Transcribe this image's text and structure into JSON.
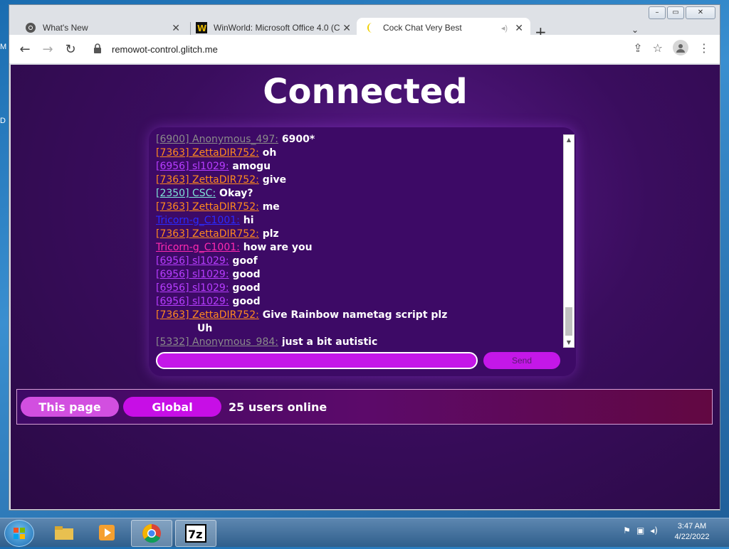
{
  "desktop": {
    "edge_letter_1": "M",
    "edge_letter_2": "D"
  },
  "window": {
    "minimize": "–",
    "maximize": "▭",
    "close": "✕"
  },
  "tabs": [
    {
      "title": "What's New",
      "icon": "chrome-icon"
    },
    {
      "title": "WinWorld: Microsoft Office 4.0 (C",
      "icon": "winworld-icon"
    },
    {
      "title": "Cock Chat Very Best",
      "icon": "moon-icon",
      "active": true
    }
  ],
  "toolbar": {
    "url": "remowot-control.glitch.me"
  },
  "page": {
    "title": "Connected",
    "messages": [
      {
        "who": "[6900] Anonymous_497:",
        "text": "6900*",
        "color": "#8a8a8a"
      },
      {
        "who": "[7363] ZettaDIR752:",
        "text": "oh",
        "color": "#ff8a1e"
      },
      {
        "who": "[6956] sl1029:",
        "text": "amogu",
        "color": "#b73dff"
      },
      {
        "who": "[7363] ZettaDIR752:",
        "text": "give",
        "color": "#ff8a1e"
      },
      {
        "who": "[2350] CSC:",
        "text": "Okay?",
        "color": "#7fe3d6"
      },
      {
        "who": "[7363] ZettaDIR752:",
        "text": "me",
        "color": "#ff8a1e"
      },
      {
        "who": "Tricorn-g_C1001:",
        "text": "hi",
        "color": "#2a2aff"
      },
      {
        "who": "[7363] ZettaDIR752:",
        "text": "plz",
        "color": "#ff8a1e"
      },
      {
        "who": "Tricorn-g_C1001:",
        "text": "how are you",
        "color": "#ff2ab0"
      },
      {
        "who": "[6956] sl1029:",
        "text": "goof",
        "color": "#b73dff"
      },
      {
        "who": "[6956] sl1029:",
        "text": "good",
        "color": "#b73dff"
      },
      {
        "who": "[6956] sl1029:",
        "text": "good",
        "color": "#b73dff"
      },
      {
        "who": "[6956] sl1029:",
        "text": "good",
        "color": "#b73dff"
      },
      {
        "who": "[7363] ZettaDIR752:",
        "text": "Give Rainbow nametag script plz",
        "color": "#ff8a1e"
      },
      {
        "who": "",
        "text": "Uh",
        "color": "#ffffff"
      },
      {
        "who": "[5332] Anonymous_984:",
        "text": "just a bit autistic",
        "color": "#8a8a8a"
      }
    ],
    "input_value": "",
    "send_label": "Send",
    "buttons": {
      "this_page": "This page",
      "global": "Global"
    },
    "online_text": "25 users online"
  },
  "taskbar": {
    "clock_time": "3:47 AM",
    "clock_date": "4/22/2022",
    "apps": [
      "file-explorer-icon",
      "media-player-icon",
      "chrome-icon",
      "7zip-icon"
    ]
  },
  "colors": {
    "accent": "#c417e8",
    "page_bg": "#3a0d5e"
  }
}
